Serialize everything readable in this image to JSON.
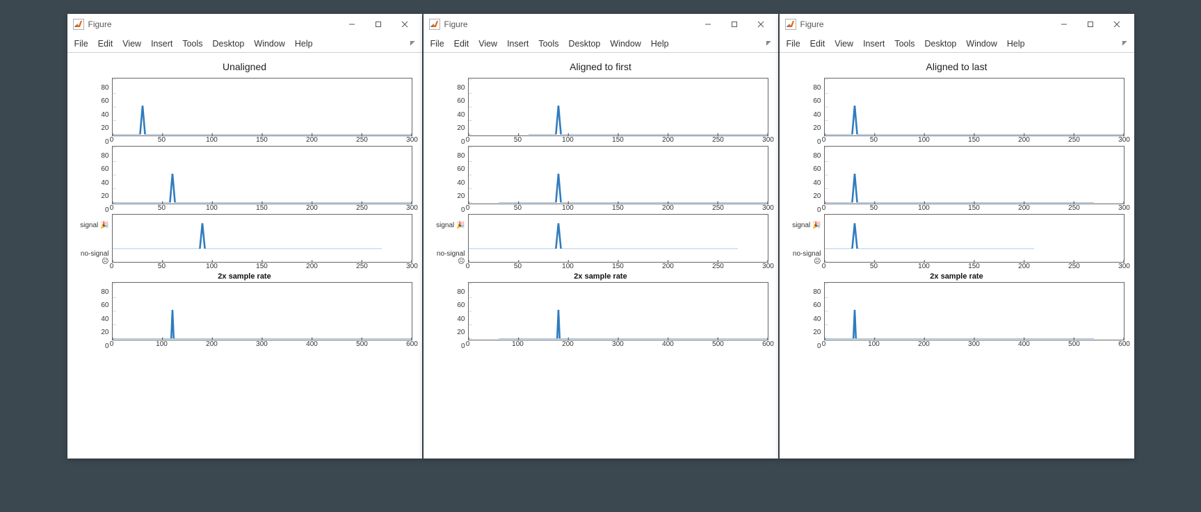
{
  "windows": [
    {
      "title": "Figure",
      "fig_title": "Unaligned"
    },
    {
      "title": "Figure",
      "fig_title": "Aligned to first"
    },
    {
      "title": "Figure",
      "fig_title": "Aligned to last"
    }
  ],
  "menu": [
    "File",
    "Edit",
    "View",
    "Insert",
    "Tools",
    "Desktop",
    "Window",
    "Help"
  ],
  "yticks_numeric": [
    "0",
    "20",
    "40",
    "60",
    "80"
  ],
  "yticks_cat": [
    "signal 🎉",
    "no-signal ☹"
  ],
  "xticks_300": [
    "0",
    "50",
    "100",
    "150",
    "200",
    "250",
    "300"
  ],
  "xticks_600": [
    "0",
    "100",
    "200",
    "300",
    "400",
    "500",
    "600"
  ],
  "subplot4_title": "2x sample rate",
  "colors": {
    "line": "#2f7bbf",
    "axis": "#666"
  },
  "chart_data": [
    {
      "window": "Unaligned",
      "subplots": [
        {
          "type": "line",
          "peak_x": 30,
          "peak_y": 42,
          "xlim": [
            0,
            300
          ],
          "ylim": [
            0,
            80
          ],
          "data_range": [
            0,
            300
          ]
        },
        {
          "type": "line",
          "peak_x": 60,
          "peak_y": 42,
          "xlim": [
            0,
            300
          ],
          "ylim": [
            0,
            80
          ],
          "data_range": [
            0,
            300
          ]
        },
        {
          "type": "line",
          "peak_x": 90,
          "peak_y": 42,
          "xlim": [
            0,
            300
          ],
          "ylim_cat": [
            "no-signal",
            "signal"
          ],
          "data_range": [
            0,
            270
          ]
        },
        {
          "type": "line",
          "peak_x": 120,
          "peak_y": 42,
          "xlim": [
            0,
            600
          ],
          "ylim": [
            0,
            80
          ],
          "data_range": [
            0,
            600
          ],
          "title": "2x sample rate"
        }
      ]
    },
    {
      "window": "Aligned to first",
      "subplots": [
        {
          "type": "line",
          "peak_x": 90,
          "peak_y": 42,
          "xlim": [
            0,
            300
          ],
          "ylim": [
            0,
            80
          ],
          "data_range": [
            60,
            300
          ]
        },
        {
          "type": "line",
          "peak_x": 90,
          "peak_y": 42,
          "xlim": [
            0,
            300
          ],
          "ylim_cat": null,
          "ylim2": [
            0,
            80
          ],
          "data_range": [
            30,
            300
          ]
        },
        {
          "type": "line",
          "peak_x": 90,
          "peak_y": 42,
          "xlim": [
            0,
            300
          ],
          "ylim_cat": [
            "no-signal",
            "signal"
          ],
          "data_range": [
            0,
            270
          ]
        },
        {
          "type": "line",
          "peak_x": 180,
          "peak_y": 42,
          "xlim": [
            0,
            600
          ],
          "ylim": [
            0,
            80
          ],
          "data_range": [
            60,
            600
          ],
          "title": "2x sample rate"
        }
      ]
    },
    {
      "window": "Aligned to last",
      "subplots": [
        {
          "type": "line",
          "peak_x": 30,
          "peak_y": 42,
          "xlim": [
            0,
            300
          ],
          "ylim": [
            0,
            80
          ],
          "data_range": [
            0,
            300
          ]
        },
        {
          "type": "line",
          "peak_x": 30,
          "peak_y": 42,
          "xlim": [
            0,
            300
          ],
          "ylim2": [
            0,
            80
          ],
          "data_range": [
            0,
            270
          ]
        },
        {
          "type": "line",
          "peak_x": 30,
          "peak_y": 42,
          "xlim": [
            0,
            300
          ],
          "ylim_cat": [
            "no-signal",
            "signal"
          ],
          "data_range": [
            0,
            210
          ]
        },
        {
          "type": "line",
          "peak_x": 60,
          "peak_y": 42,
          "xlim": [
            0,
            600
          ],
          "ylim": [
            0,
            80
          ],
          "data_range": [
            0,
            540
          ],
          "title": "2x sample rate"
        }
      ]
    }
  ]
}
